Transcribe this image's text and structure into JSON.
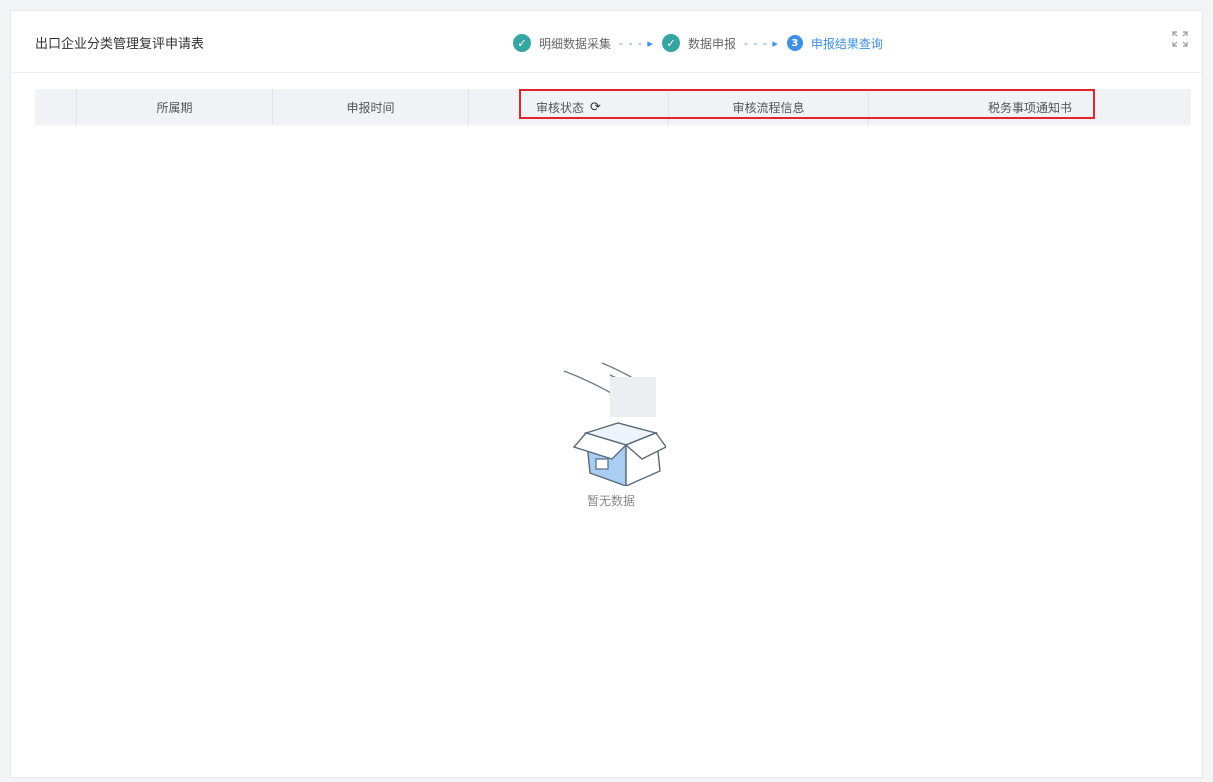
{
  "header": {
    "title": "出口企业分类管理复评申请表",
    "steps": [
      {
        "label": "明细数据采集",
        "state": "done"
      },
      {
        "label": "数据申报",
        "state": "done"
      },
      {
        "number": "3",
        "label": "申报结果查询",
        "state": "active"
      }
    ],
    "step_arrow": "- - - ▸"
  },
  "table": {
    "columns": [
      "所属期",
      "申报时间",
      "审核状态",
      "审核流程信息",
      "税务事项通知书"
    ],
    "rows": []
  },
  "empty_state": {
    "text": "暂无数据"
  },
  "colors": {
    "accent": "#3d8fe8",
    "done": "#35a6a3",
    "highlight": "#e0262c"
  },
  "icons": {
    "fullscreen": "fullscreen-icon",
    "refresh": "refresh-icon",
    "empty": "empty-box-icon"
  }
}
